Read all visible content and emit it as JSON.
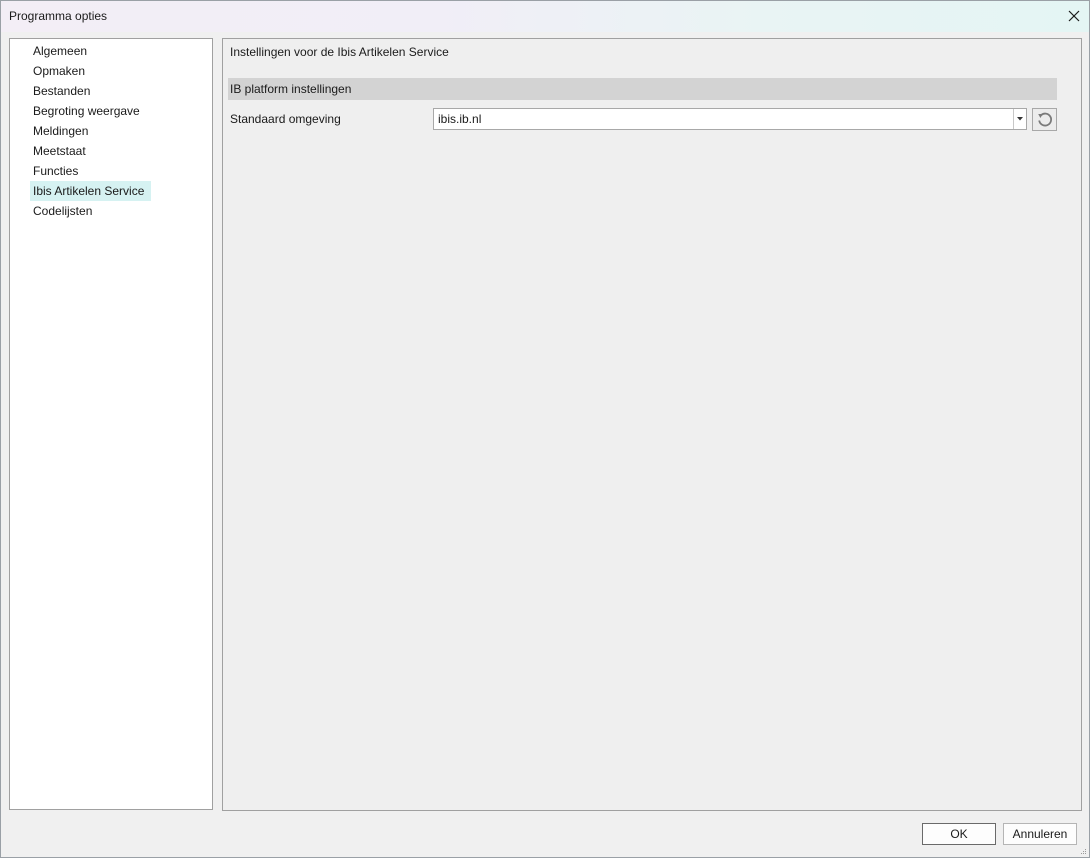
{
  "window": {
    "title": "Programma opties"
  },
  "sidebar": {
    "items": [
      {
        "label": "Algemeen",
        "selected": false
      },
      {
        "label": "Opmaken",
        "selected": false
      },
      {
        "label": "Bestanden",
        "selected": false
      },
      {
        "label": "Begroting weergave",
        "selected": false
      },
      {
        "label": "Meldingen",
        "selected": false
      },
      {
        "label": "Meetstaat",
        "selected": false
      },
      {
        "label": "Functies",
        "selected": false
      },
      {
        "label": "Ibis Artikelen Service",
        "selected": true
      },
      {
        "label": "Codelijsten",
        "selected": false
      }
    ]
  },
  "main": {
    "heading": "Instellingen voor de Ibis Artikelen Service",
    "section_title": "IB platform instellingen",
    "field_label": "Standaard omgeving",
    "field_value": "ibis.ib.nl"
  },
  "footer": {
    "ok_label": "OK",
    "cancel_label": "Annuleren"
  },
  "colors": {
    "selected_bg": "#d6f2f2",
    "section_bg": "#d3d3d3",
    "panel_bg": "#efefef"
  },
  "icons": {
    "close": "close-icon",
    "dropdown": "chevron-down-icon",
    "reset": "reset-icon",
    "grip": "resize-grip-icon"
  }
}
